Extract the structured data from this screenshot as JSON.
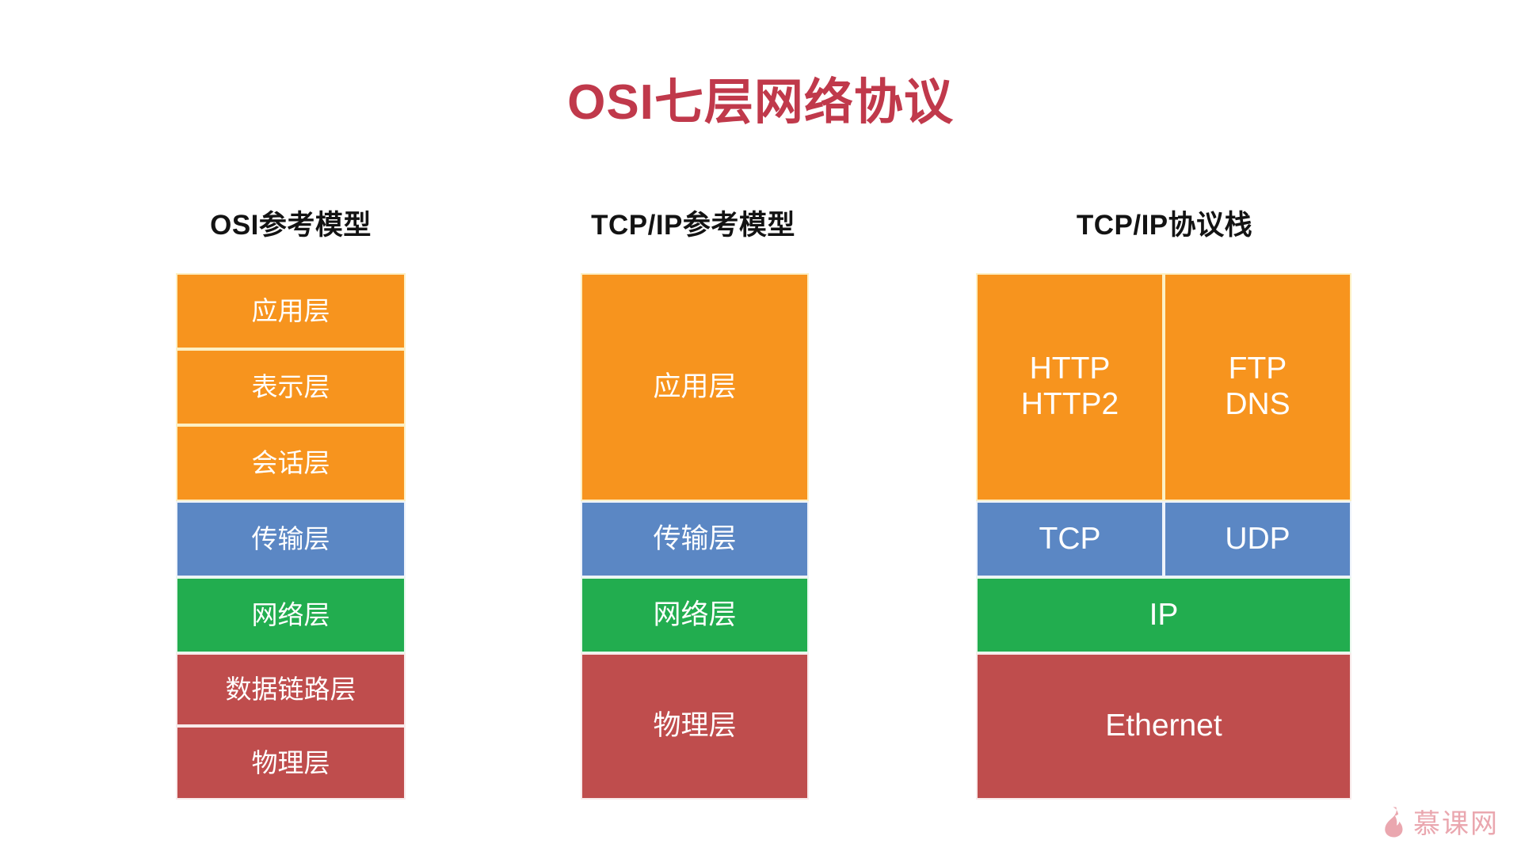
{
  "title": "OSI七层网络协议",
  "title_color": "#c0394b",
  "colors": {
    "orange": "#f7941e",
    "blue": "#5b87c4",
    "green": "#22ad4f",
    "red": "#bf4d4d",
    "background": "#ffffff",
    "header_text": "#131313",
    "watermark": "#e9a3ab"
  },
  "columns": {
    "osi": {
      "header": "OSI参考模型",
      "layers": [
        {
          "label": "应用层",
          "color": "orange"
        },
        {
          "label": "表示层",
          "color": "orange"
        },
        {
          "label": "会话层",
          "color": "orange"
        },
        {
          "label": "传输层",
          "color": "blue"
        },
        {
          "label": "网络层",
          "color": "green"
        },
        {
          "label": "数据链路层",
          "color": "red"
        },
        {
          "label": "物理层",
          "color": "red"
        }
      ]
    },
    "tcpip_model": {
      "header": "TCP/IP参考模型",
      "layers": [
        {
          "label": "应用层",
          "color": "orange"
        },
        {
          "label": "传输层",
          "color": "blue"
        },
        {
          "label": "网络层",
          "color": "green"
        },
        {
          "label": "物理层",
          "color": "red"
        }
      ]
    },
    "tcpip_stack": {
      "header": "TCP/IP协议栈",
      "application": {
        "left": "HTTP\nHTTP2",
        "right": "FTP\nDNS",
        "color": "orange"
      },
      "transport": {
        "left": "TCP",
        "right": "UDP",
        "color": "blue"
      },
      "network": {
        "label": "IP",
        "color": "green"
      },
      "link": {
        "label": "Ethernet",
        "color": "red"
      }
    }
  },
  "watermark": {
    "icon": "flame-icon",
    "text": "慕课网"
  }
}
